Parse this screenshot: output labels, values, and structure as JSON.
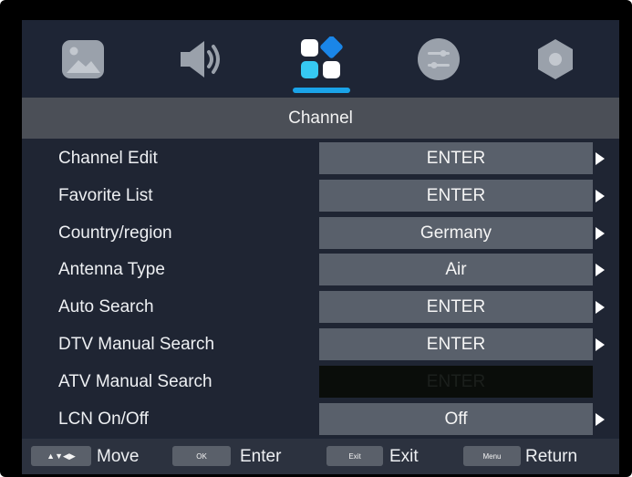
{
  "top_tabs": [
    {
      "icon": "picture-icon"
    },
    {
      "icon": "sound-icon"
    },
    {
      "icon": "channel-icon",
      "active": true
    },
    {
      "icon": "function-icon"
    },
    {
      "icon": "settings-icon"
    }
  ],
  "title": "Channel",
  "menu_items": [
    {
      "label": "Channel Edit",
      "value": "ENTER",
      "enabled": true
    },
    {
      "label": "Favorite List",
      "value": "ENTER",
      "enabled": true
    },
    {
      "label": "Country/region",
      "value": "Germany",
      "enabled": true
    },
    {
      "label": "Antenna Type",
      "value": "Air",
      "enabled": true
    },
    {
      "label": "Auto Search",
      "value": "ENTER",
      "enabled": true
    },
    {
      "label": "DTV Manual Search",
      "value": "ENTER",
      "enabled": true
    },
    {
      "label": "ATV Manual Search",
      "value": "ENTER",
      "enabled": false
    },
    {
      "label": "LCN On/Off",
      "value": "Off",
      "enabled": true
    }
  ],
  "footer": {
    "move": {
      "key": "▲▼◀▶",
      "label": "Move"
    },
    "enter": {
      "key": "OK",
      "label": "Enter"
    },
    "exit": {
      "key": "Exit",
      "label": "Exit"
    },
    "menu": {
      "key": "Menu",
      "label": "Return"
    }
  },
  "colors": {
    "accent": "#1aa3e8",
    "background": "#1f2533",
    "value_box": "#59606b",
    "disabled_box": "#0a0d0a"
  }
}
